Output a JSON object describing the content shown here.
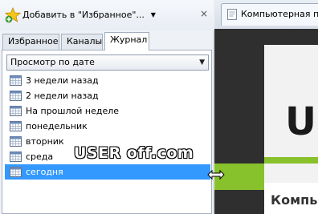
{
  "favorites_pane": {
    "add_button_label": "Добавить в \"Избранное\"...",
    "close_label": "×",
    "tabs": [
      {
        "label": "Избранное",
        "active": false
      },
      {
        "label": "Каналы",
        "active": false
      },
      {
        "label": "Журнал",
        "active": true
      }
    ],
    "view_select": {
      "selected": "Просмотр по дате"
    },
    "history_items": [
      {
        "label": "3 недели назад",
        "icon": "calendar-icon"
      },
      {
        "label": "2 недели назад",
        "icon": "calendar-icon"
      },
      {
        "label": "На прошлой неделе",
        "icon": "calendar-icon"
      },
      {
        "label": "понедельник",
        "icon": "calendar-icon"
      },
      {
        "label": "вторник",
        "icon": "calendar-icon"
      },
      {
        "label": "среда",
        "icon": "calendar-icon"
      },
      {
        "label": "сегодня",
        "icon": "calendar-icon",
        "selected": true
      }
    ]
  },
  "browser": {
    "tab_title": "Компьютерная п",
    "page_logo_letter": "U",
    "page_heading": "Компь"
  },
  "watermark": "USER off.com",
  "colors": {
    "selection": "#3399ff",
    "accent_green": "#87c12b",
    "page_dark": "#2f2f2f"
  }
}
